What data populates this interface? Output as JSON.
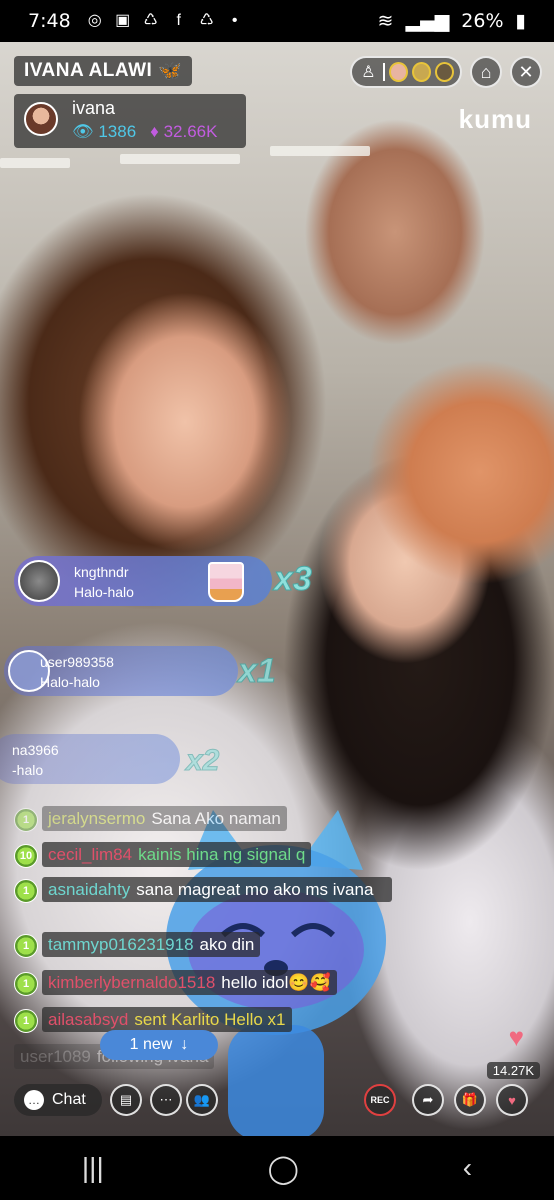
{
  "status_bar": {
    "time": "7:48",
    "battery": "26%",
    "notification_icons": [
      "messenger-icon",
      "app-icon",
      "recycle-icon",
      "facebook-icon",
      "recycle-icon",
      "dot-icon"
    ]
  },
  "stream": {
    "title": "IVANA ALAWI",
    "title_emoji": "🦋",
    "host_name": "ivana",
    "viewers": "1386",
    "diamonds": "32.66K",
    "brand": "kumu"
  },
  "gifts": [
    {
      "user": "kngthndr",
      "item": "Halo-halo",
      "multiplier": "x3"
    },
    {
      "user": "user989358",
      "item": "Halo-halo",
      "multiplier": "x1"
    },
    {
      "user": "na3966",
      "item": "-halo",
      "multiplier": "x2"
    }
  ],
  "chat": [
    {
      "level": "1",
      "user": "jeralynsermo",
      "text": "Sana Ako naman",
      "color": "#c7d44a"
    },
    {
      "level": "10",
      "user": "cecil_lim84",
      "text": "kainis hina ng signal q",
      "color": "#e0506a"
    },
    {
      "level": "1",
      "user": "asnaidahty",
      "text": "sana magreat mo ako ms ivana",
      "color": "#6ed6cf"
    },
    {
      "level": "1",
      "user": "tammyp016231918",
      "text": "ako din",
      "color": "#6ed6cf"
    },
    {
      "level": "1",
      "user": "kimberlybernaldo1518",
      "text": "hello idol😊🥰",
      "color": "#e0506a"
    },
    {
      "level": "1",
      "user": "ailasabsyd",
      "text": "sent Karlito Hello x1",
      "color": "#e0506a"
    },
    {
      "level": "",
      "user": "user1089",
      "text": "following ivana",
      "color": "#aaaaaa"
    }
  ],
  "new_messages": "1 new",
  "bottom": {
    "chat_label": "Chat",
    "likes": "14.27K",
    "rec_label": "REC"
  },
  "colors": {
    "viewers": "#4fc8e8",
    "diamonds": "#c25ce0",
    "new_pill": "#4a88d8"
  }
}
